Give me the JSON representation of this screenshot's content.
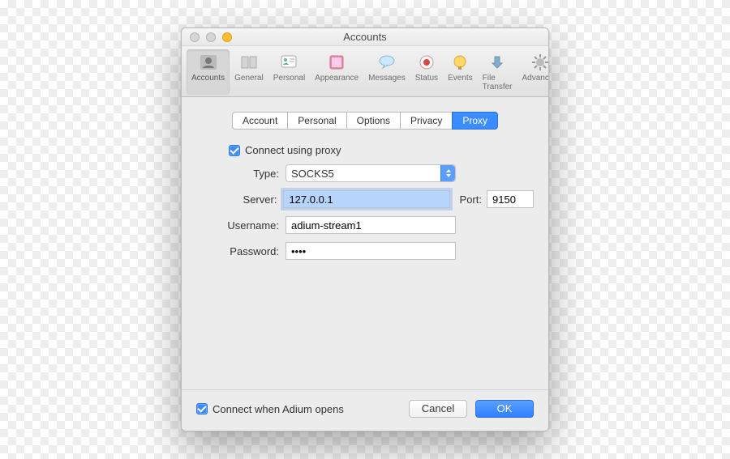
{
  "window": {
    "title": "Accounts"
  },
  "toolbar": {
    "items": [
      {
        "label": "Accounts",
        "icon": "accounts-icon"
      },
      {
        "label": "General",
        "icon": "general-icon"
      },
      {
        "label": "Personal",
        "icon": "personal-icon"
      },
      {
        "label": "Appearance",
        "icon": "appearance-icon"
      },
      {
        "label": "Messages",
        "icon": "messages-icon"
      },
      {
        "label": "Status",
        "icon": "status-icon"
      },
      {
        "label": "Events",
        "icon": "events-icon"
      },
      {
        "label": "File Transfer",
        "icon": "file-transfer-icon"
      },
      {
        "label": "Advanced",
        "icon": "advanced-icon"
      }
    ]
  },
  "tabs": {
    "items": [
      {
        "label": "Account"
      },
      {
        "label": "Personal"
      },
      {
        "label": "Options"
      },
      {
        "label": "Privacy"
      },
      {
        "label": "Proxy"
      }
    ]
  },
  "form": {
    "connect_proxy_label": "Connect using proxy",
    "type_label": "Type:",
    "type_value": "SOCKS5",
    "server_label": "Server:",
    "server_value": "127.0.0.1",
    "port_label": "Port:",
    "port_value": "9150",
    "username_label": "Username:",
    "username_value": "adium-stream1",
    "password_label": "Password:",
    "password_value": "••••"
  },
  "footer": {
    "connect_open_label": "Connect when Adium opens",
    "cancel": "Cancel",
    "ok": "OK"
  }
}
